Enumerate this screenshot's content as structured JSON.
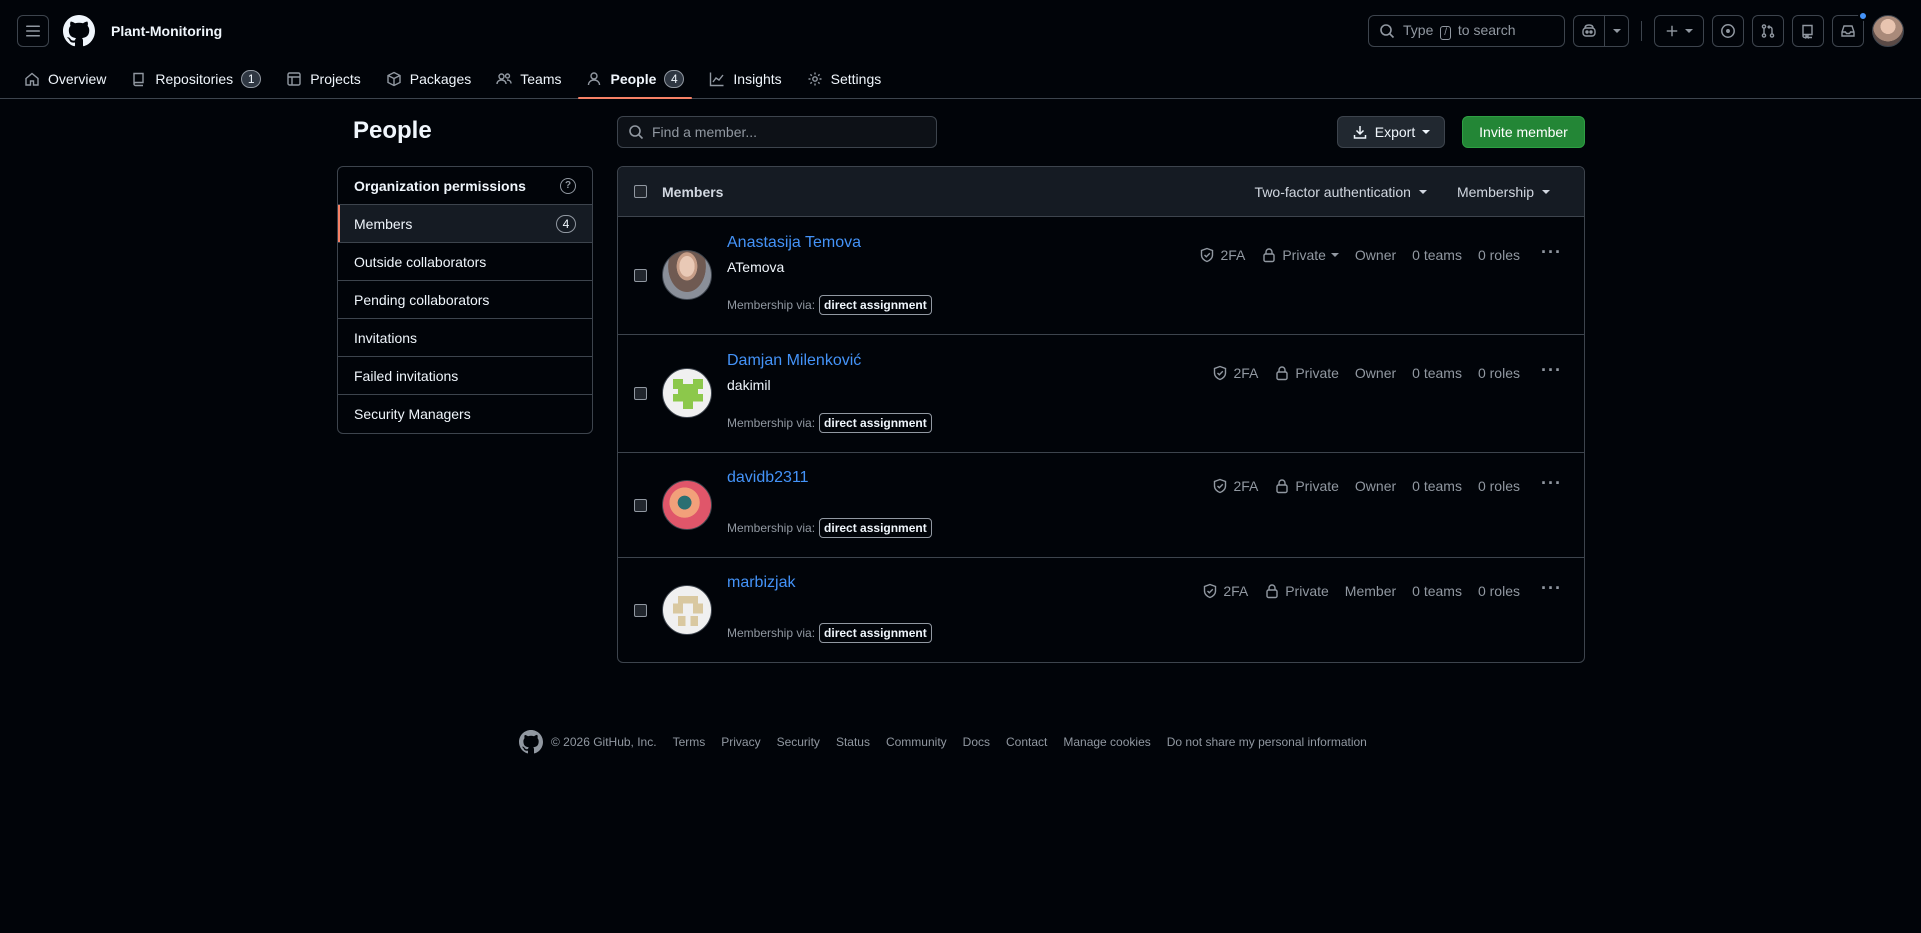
{
  "header": {
    "org_name": "Plant-Monitoring",
    "search": {
      "prefix": "Type",
      "key": "/",
      "suffix": "to search"
    },
    "nav": [
      {
        "label": "Overview",
        "icon": "home-icon"
      },
      {
        "label": "Repositories",
        "icon": "repo-icon",
        "count": "1"
      },
      {
        "label": "Projects",
        "icon": "table-icon"
      },
      {
        "label": "Packages",
        "icon": "package-icon"
      },
      {
        "label": "Teams",
        "icon": "people-icon"
      },
      {
        "label": "People",
        "icon": "person-icon",
        "count": "4",
        "active": true
      },
      {
        "label": "Insights",
        "icon": "graph-icon"
      },
      {
        "label": "Settings",
        "icon": "gear-icon"
      }
    ]
  },
  "page": {
    "title": "People",
    "find_placeholder": "Find a member...",
    "export_label": "Export",
    "invite_label": "Invite member"
  },
  "sidebar": {
    "heading": "Organization permissions",
    "help": "?",
    "items": [
      {
        "label": "Members",
        "count": "4",
        "selected": true
      },
      {
        "label": "Outside collaborators"
      },
      {
        "label": "Pending collaborators"
      },
      {
        "label": "Invitations"
      },
      {
        "label": "Failed invitations"
      },
      {
        "label": "Security Managers"
      }
    ]
  },
  "members": {
    "heading": "Members",
    "filter_2fa": "Two-factor authentication",
    "filter_membership": "Membership",
    "via_label": "Membership via:",
    "rows": [
      {
        "name": "Anastasija Temova",
        "login": "ATemova",
        "twofa": "2FA",
        "visibility": "Private",
        "role": "Owner",
        "teams": "0 teams",
        "roles": "0 roles",
        "via": "direct assignment"
      },
      {
        "name": "Damjan Milenković",
        "login": "dakimil",
        "twofa": "2FA",
        "visibility": "Private",
        "role": "Owner",
        "teams": "0 teams",
        "roles": "0 roles",
        "via": "direct assignment"
      },
      {
        "name": "davidb2311",
        "login": "",
        "twofa": "2FA",
        "visibility": "Private",
        "role": "Owner",
        "teams": "0 teams",
        "roles": "0 roles",
        "via": "direct assignment"
      },
      {
        "name": "marbizjak",
        "login": "",
        "twofa": "2FA",
        "visibility": "Private",
        "role": "Member",
        "teams": "0 teams",
        "roles": "0 roles",
        "via": "direct assignment"
      }
    ]
  },
  "footer": {
    "copyright": "© 2026 GitHub, Inc.",
    "links": [
      "Terms",
      "Privacy",
      "Security",
      "Status",
      "Community",
      "Docs",
      "Contact",
      "Manage cookies",
      "Do not share my personal information"
    ]
  },
  "colors": {
    "accent": "#4493f8",
    "nav_underline": "#f78166",
    "invite_bg": "#238636"
  }
}
